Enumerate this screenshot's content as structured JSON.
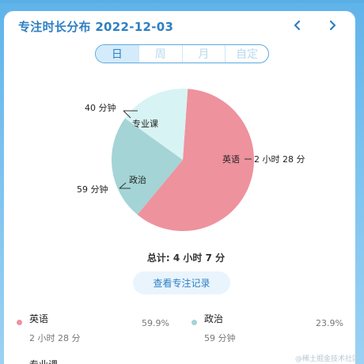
{
  "header": {
    "title": "专注时长分布 2022-12-03",
    "prev_icon": "chevron-left-icon",
    "next_icon": "chevron-right-icon"
  },
  "period_tabs": {
    "items": [
      {
        "label": "日",
        "active": true
      },
      {
        "label": "周",
        "active": false
      },
      {
        "label": "月",
        "active": false
      },
      {
        "label": "自定",
        "active": false
      }
    ]
  },
  "chart_data": {
    "type": "pie",
    "slices": [
      {
        "name": "英语",
        "value": 59.9,
        "label": "2 小时 28 分",
        "color": "#ee929e"
      },
      {
        "name": "政治",
        "value": 23.9,
        "label": "59 分钟",
        "color": "#a4d4d6"
      },
      {
        "name": "专业课",
        "value": 16.2,
        "label": "40 分钟",
        "color": "#d8f3f3"
      }
    ]
  },
  "summary": {
    "total": "总计: 4 小时 7 分",
    "records_button": "查看专注记录"
  },
  "legend": [
    {
      "name": "英语",
      "time": "2 小时 28 分",
      "percent": "59.9%",
      "color": "#ee929e"
    },
    {
      "name": "政治",
      "time": "59 分钟",
      "percent": "23.9%",
      "color": "#a4d4d6"
    },
    {
      "name": "专业课"
    }
  ],
  "watermark": "@稀土掘金技术社区"
}
